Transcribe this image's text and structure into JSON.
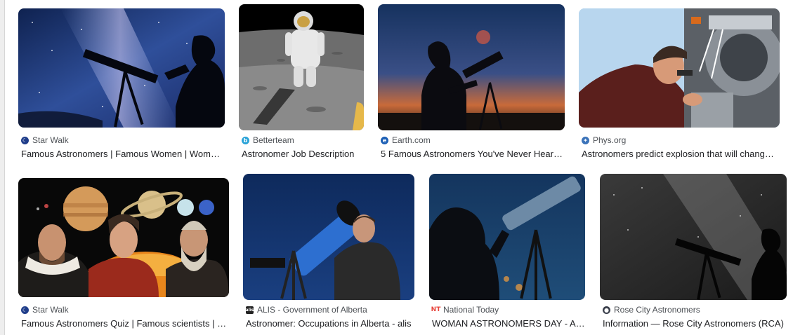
{
  "results": [
    {
      "source": "Star Walk",
      "title": "Famous Astronomers | Famous Women | Women ...",
      "favicon": "starwalk-icon",
      "fav_color": "#1f3d8a"
    },
    {
      "source": "Betterteam",
      "title": "Astronomer Job Description",
      "favicon": "betterteam-icon",
      "fav_color": "#2aa3d8"
    },
    {
      "source": "Earth.com",
      "title": "5 Famous Astronomers You've Never Heard ...",
      "favicon": "earth-icon",
      "fav_color": "#1c5fb5"
    },
    {
      "source": "Phys.org",
      "title": "Astronomers predict explosion that will change t...",
      "favicon": "physorg-icon",
      "fav_color": "#3b73b9"
    },
    {
      "source": "Star Walk",
      "title": "Famous Astronomers Quiz | Famous scientists | Hi...",
      "favicon": "starwalk-icon",
      "fav_color": "#1f3d8a"
    },
    {
      "source": "ALIS - Government of Alberta",
      "title": "Astronomer: Occupations in Alberta - alis",
      "favicon": "alis-icon",
      "fav_color": "#222222"
    },
    {
      "source": "National Today",
      "title": "WOMAN ASTRONOMERS DAY - Augu...",
      "favicon": "nationaltoday-icon",
      "fav_color": "#e8453c"
    },
    {
      "source": "Rose City Astronomers",
      "title": "Information — Rose City Astronomers (RCA)",
      "favicon": "rosecity-icon",
      "fav_color": "#3a3f4b"
    }
  ]
}
